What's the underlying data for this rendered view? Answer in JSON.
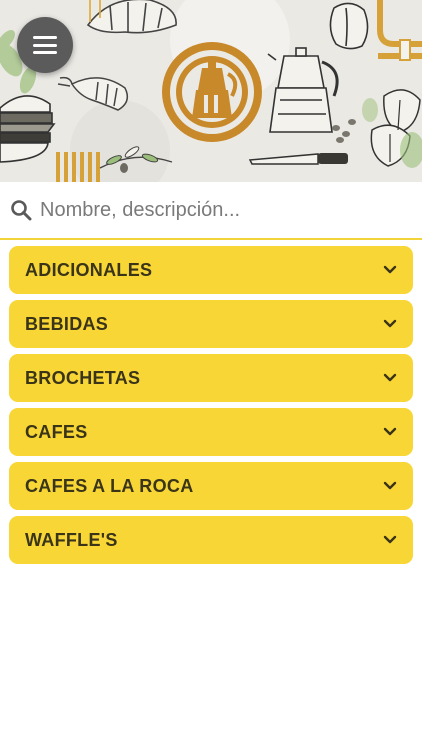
{
  "header": {
    "menu_icon": "hamburger-menu-icon",
    "logo_icon": "moka-pot-logo-icon"
  },
  "search": {
    "placeholder": "Nombre, descripción...",
    "icon": "search-icon"
  },
  "categories": [
    {
      "label": "ADICIONALES"
    },
    {
      "label": "BEBIDAS"
    },
    {
      "label": "BROCHETAS"
    },
    {
      "label": "CAFES"
    },
    {
      "label": "CAFES A LA ROCA"
    },
    {
      "label": "WAFFLE'S"
    }
  ],
  "colors": {
    "accent": "#f8d636",
    "label_text": "#3a3418",
    "logo": "#c8892b",
    "menu_button": "#5b5b5b"
  }
}
